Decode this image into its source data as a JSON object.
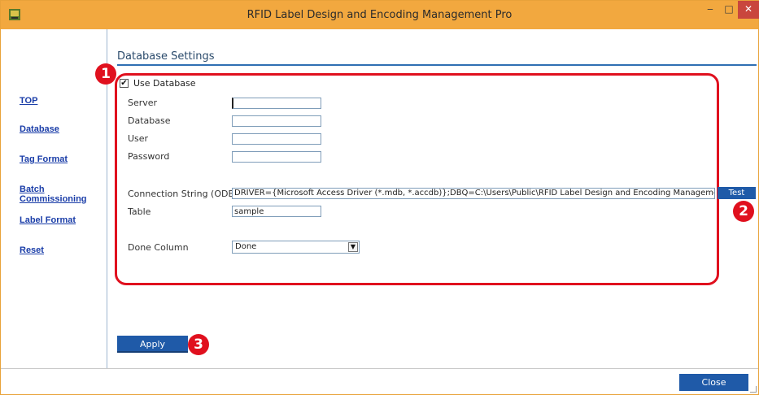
{
  "window": {
    "title": "RFID Label Design and Encoding Management Pro",
    "controls": {
      "minimize": "‒",
      "maximize": "□",
      "close": "✕"
    }
  },
  "sidebar": {
    "items": [
      {
        "label": "TOP"
      },
      {
        "label": "Database"
      },
      {
        "label": "Tag Format"
      },
      {
        "label": "Batch Commissioning"
      },
      {
        "label": "Label Format"
      },
      {
        "label": "Reset"
      }
    ]
  },
  "main": {
    "title": "Database Settings",
    "use_database": {
      "label": "Use Database",
      "checked": true,
      "mark": "✔"
    },
    "fields": {
      "server": {
        "label": "Server",
        "value": ""
      },
      "database": {
        "label": "Database",
        "value": ""
      },
      "user": {
        "label": "User",
        "value": ""
      },
      "password": {
        "label": "Password",
        "value": ""
      },
      "connection_string": {
        "label": "Connection String (ODBC)",
        "value": "DRIVER={Microsoft Access Driver (*.mdb, *.accdb)};DBQ=C:\\Users\\Public\\RFID Label Design and Encoding Management Pro\\SampleData\\"
      },
      "table": {
        "label": "Table",
        "value": "sample"
      },
      "done_column": {
        "label": "Done Column",
        "value": "Done",
        "arrow": "▼"
      }
    },
    "test_button": "Test",
    "apply_button": "Apply"
  },
  "footer": {
    "close_button": "Close"
  },
  "markers": {
    "m1": "1",
    "m2": "2",
    "m3": "3"
  },
  "colors": {
    "titlebar": "#f2a83f",
    "accent": "#1f5aa8",
    "annotation": "#e0101e",
    "link": "#1a3da8"
  }
}
